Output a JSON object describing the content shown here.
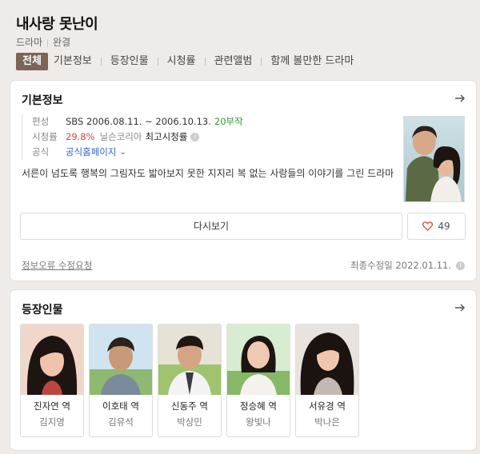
{
  "header": {
    "title": "내사랑 못난이",
    "genre": "드라마",
    "status": "완결",
    "tabs": [
      "전체",
      "기본정보",
      "등장인물",
      "시청률",
      "관련앨범",
      "함께 볼만한 드라마"
    ]
  },
  "basic": {
    "title": "기본정보",
    "rows": {
      "schedule": {
        "label": "편성",
        "channel": "SBS",
        "period": "2006.08.11. ~ 2006.10.13.",
        "episodes": "20부작"
      },
      "rating": {
        "label": "시청률",
        "value": "29.8%",
        "source": "닐슨코리아",
        "note": "최고시청률"
      },
      "official": {
        "label": "공식",
        "link": "공식홈페이지"
      }
    },
    "description": "서른이 넘도록 행복의 그림자도 밟아보지 못한 지지리 복 없는 사람들의 이야기를 그린 드라마",
    "replay_label": "다시보기",
    "like_count": "49",
    "error_report": "정보오류 수정요청",
    "last_modified": "최종수정일 2022.01.11."
  },
  "cast": {
    "title": "등장인물",
    "people": [
      {
        "role": "진자연 역",
        "actor": "김지영"
      },
      {
        "role": "이호태 역",
        "actor": "김유석"
      },
      {
        "role": "신동주 역",
        "actor": "박상민"
      },
      {
        "role": "정승혜 역",
        "actor": "왕빛나"
      },
      {
        "role": "서유경 역",
        "actor": "박나은"
      }
    ]
  },
  "colors": {
    "accent_tab": "#7b6458",
    "link_blue": "#3366cc",
    "episodes_green": "#339933",
    "rating_red": "#e0443e"
  },
  "icons": [
    "arrow-right-icon",
    "info-icon",
    "chevron-down-icon",
    "heart-icon"
  ]
}
